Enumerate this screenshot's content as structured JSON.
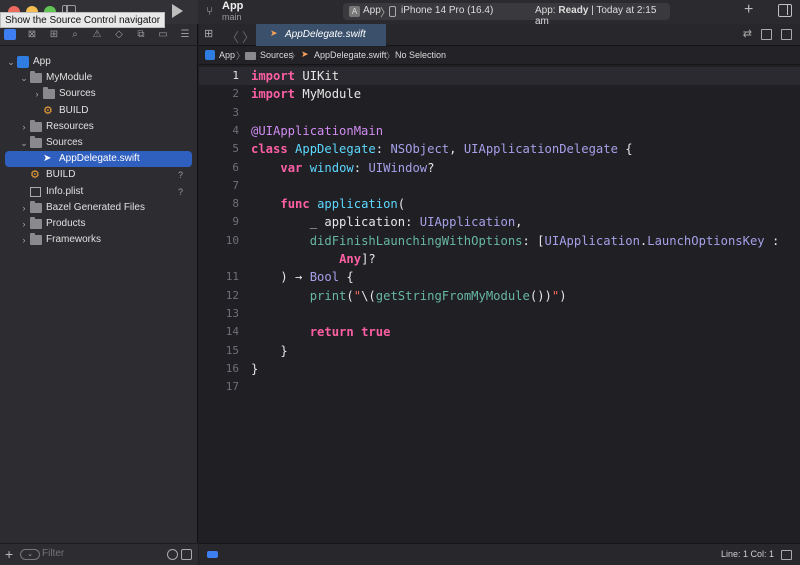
{
  "toolbar": {
    "tooltip": "Show the Source Control navigator",
    "project_name": "App",
    "branch_name": "main",
    "scheme_app": "App",
    "scheme_device": "iPhone 14 Pro (16.4)",
    "status_prefix": "App: ",
    "status_bold": "Ready",
    "status_suffix": " | Today at 2:15 am",
    "plus": "+"
  },
  "navigator": {
    "tree": [
      {
        "label": "App",
        "depth": 0,
        "disclosure": "open",
        "icon": "app-project-icon",
        "badge": ""
      },
      {
        "label": "MyModule",
        "depth": 1,
        "disclosure": "open",
        "icon": "folder-icon",
        "badge": ""
      },
      {
        "label": "Sources",
        "depth": 2,
        "disclosure": "closed",
        "icon": "folder-icon",
        "badge": ""
      },
      {
        "label": "BUILD",
        "depth": 2,
        "disclosure": "none",
        "icon": "bazel-icon",
        "badge": ""
      },
      {
        "label": "Resources",
        "depth": 1,
        "disclosure": "closed",
        "icon": "folder-icon",
        "badge": ""
      },
      {
        "label": "Sources",
        "depth": 1,
        "disclosure": "open",
        "icon": "folder-icon",
        "badge": ""
      },
      {
        "label": "AppDelegate.swift",
        "depth": 2,
        "disclosure": "none",
        "icon": "swift-file-icon",
        "badge": "",
        "selected": true
      },
      {
        "label": "BUILD",
        "depth": 1,
        "disclosure": "none",
        "icon": "bazel-icon",
        "badge": "?"
      },
      {
        "label": "Info.plist",
        "depth": 1,
        "disclosure": "none",
        "icon": "plist-icon",
        "badge": "?"
      },
      {
        "label": "Bazel Generated Files",
        "depth": 1,
        "disclosure": "closed",
        "icon": "folder-icon",
        "badge": ""
      },
      {
        "label": "Products",
        "depth": 1,
        "disclosure": "closed",
        "icon": "folder-icon",
        "badge": ""
      },
      {
        "label": "Frameworks",
        "depth": 1,
        "disclosure": "closed",
        "icon": "folder-icon",
        "badge": ""
      }
    ],
    "filter_placeholder": "Filter",
    "plus": "+"
  },
  "editor": {
    "tab_label": "AppDelegate.swift",
    "jumpbar": [
      "App",
      "Sources",
      "AppDelegate.swift",
      "No Selection"
    ],
    "lines": [
      [
        [
          "kw",
          "import"
        ],
        [
          "plain",
          " UIKit"
        ]
      ],
      [
        [
          "kw",
          "import"
        ],
        [
          "plain",
          " MyModule"
        ]
      ],
      [],
      [
        [
          "attr",
          "@UIApplicationMain"
        ]
      ],
      [
        [
          "kw",
          "class"
        ],
        [
          "plain",
          " "
        ],
        [
          "decl",
          "AppDelegate"
        ],
        [
          "plain",
          ": "
        ],
        [
          "tp",
          "NSObject"
        ],
        [
          "plain",
          ", "
        ],
        [
          "tp",
          "UIApplicationDelegate"
        ],
        [
          "plain",
          " {"
        ]
      ],
      [
        [
          "plain",
          "    "
        ],
        [
          "kw",
          "var"
        ],
        [
          "plain",
          " "
        ],
        [
          "decl",
          "window"
        ],
        [
          "plain",
          ": "
        ],
        [
          "tp",
          "UIWindow"
        ],
        [
          "plain",
          "?"
        ]
      ],
      [],
      [
        [
          "plain",
          "    "
        ],
        [
          "kw",
          "func"
        ],
        [
          "plain",
          " "
        ],
        [
          "decl",
          "application"
        ],
        [
          "plain",
          "("
        ]
      ],
      [
        [
          "plain",
          "        _ application: "
        ],
        [
          "tp",
          "UIApplication"
        ],
        [
          "plain",
          ","
        ]
      ],
      [
        [
          "plain",
          "        "
        ],
        [
          "call",
          "didFinishLaunchingWithOptions"
        ],
        [
          "plain",
          ": ["
        ],
        [
          "tp",
          "UIApplication"
        ],
        [
          "plain",
          "."
        ],
        [
          "tp",
          "LaunchOptionsKey"
        ],
        [
          "plain",
          " :"
        ]
      ],
      [
        [
          "plain",
          "            "
        ],
        [
          "kw",
          "Any"
        ],
        [
          "plain",
          "]?"
        ]
      ],
      [
        [
          "plain",
          "    ) → "
        ],
        [
          "tp",
          "Bool"
        ],
        [
          "plain",
          " {"
        ]
      ],
      [
        [
          "plain",
          "        "
        ],
        [
          "call",
          "print"
        ],
        [
          "plain",
          "("
        ],
        [
          "str",
          "\""
        ],
        [
          "plain",
          "\\("
        ],
        [
          "call",
          "getStringFromMyModule"
        ],
        [
          "plain",
          "())"
        ],
        [
          "str",
          "\""
        ],
        [
          "plain",
          ")"
        ]
      ],
      [],
      [
        [
          "plain",
          "        "
        ],
        [
          "kw",
          "return"
        ],
        [
          "plain",
          " "
        ],
        [
          "kw",
          "true"
        ]
      ],
      [
        [
          "plain",
          "    }"
        ]
      ],
      [
        [
          "plain",
          "}"
        ]
      ],
      []
    ],
    "line_numbers": [
      "1",
      "2",
      "3",
      "4",
      "5",
      "6",
      "7",
      "8",
      "9",
      "10",
      "",
      "11",
      "12",
      "13",
      "14",
      "15",
      "16",
      "17"
    ],
    "status_position": "Line: 1  Col: 1"
  }
}
